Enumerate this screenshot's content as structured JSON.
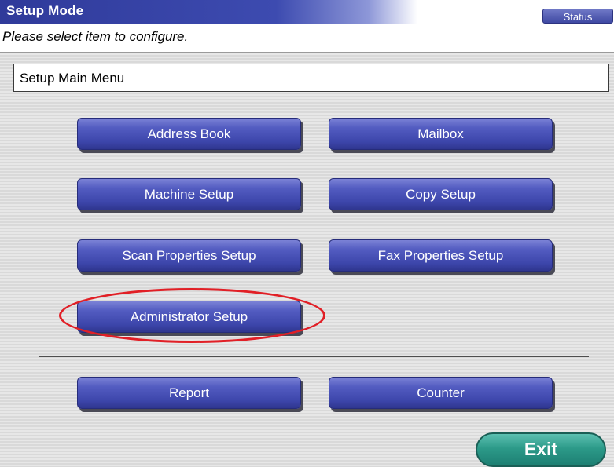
{
  "header": {
    "title": "Setup Mode",
    "status_label": "Status"
  },
  "instruction": "Please select item to configure.",
  "menu_header": "Setup Main Menu",
  "buttons": {
    "address_book": "Address Book",
    "mailbox": "Mailbox",
    "machine_setup": "Machine Setup",
    "copy_setup": "Copy Setup",
    "scan_properties_setup": "Scan Properties Setup",
    "fax_properties_setup": "Fax Properties Setup",
    "administrator_setup": "Administrator Setup",
    "report": "Report",
    "counter": "Counter",
    "exit": "Exit"
  },
  "colors": {
    "title_bar": "#2f3a9a",
    "button_blue": "#4a53b8",
    "exit_green": "#2c9a89",
    "highlight_red": "#e11f26"
  }
}
